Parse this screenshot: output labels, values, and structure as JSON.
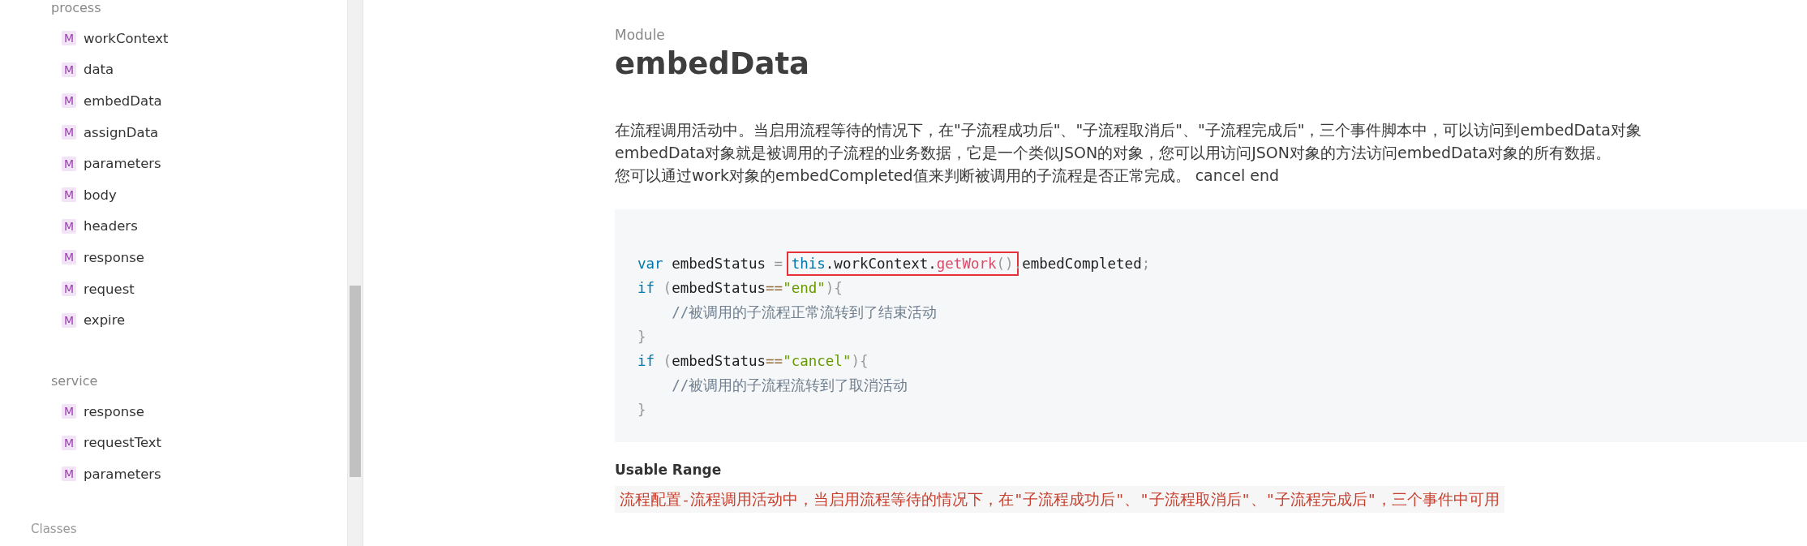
{
  "sidebar": {
    "groups": [
      {
        "title": "process",
        "items": [
          {
            "badge": "M",
            "label": "workContext"
          },
          {
            "badge": "M",
            "label": "data"
          },
          {
            "badge": "M",
            "label": "embedData"
          },
          {
            "badge": "M",
            "label": "assignData"
          },
          {
            "badge": "M",
            "label": "parameters"
          },
          {
            "badge": "M",
            "label": "body"
          },
          {
            "badge": "M",
            "label": "headers"
          },
          {
            "badge": "M",
            "label": "response"
          },
          {
            "badge": "M",
            "label": "request"
          },
          {
            "badge": "M",
            "label": "expire"
          }
        ]
      },
      {
        "title": "service",
        "items": [
          {
            "badge": "M",
            "label": "response"
          },
          {
            "badge": "M",
            "label": "requestText"
          },
          {
            "badge": "M",
            "label": "parameters"
          }
        ]
      }
    ],
    "section": "Classes"
  },
  "main": {
    "kicker": "Module",
    "title": "embedData",
    "description": [
      "在流程调用活动中。当启用流程等待的情况下，在\"子流程成功后\"、\"子流程取消后\"、\"子流程完成后\"，三个事件脚本中，可以访问到embedData对象",
      "embedData对象就是被调用的子流程的业务数据，它是一个类似JSON的对象，您可以用访问JSON对象的方法访问embedData对象的所有数据。",
      "您可以通过work对象的embedCompleted值来判断被调用的子流程是否正常完成。 cancel end"
    ],
    "code": [
      {
        "segments": [
          {
            "boxed": false,
            "tokens": [
              {
                "kind": "keyword",
                "text": "var"
              },
              {
                "kind": "plain",
                "text": " embedStatus "
              },
              {
                "kind": "punct",
                "text": "= "
              }
            ]
          },
          {
            "boxed": true,
            "tokens": [
              {
                "kind": "keyword",
                "text": "this"
              },
              {
                "kind": "plain",
                "text": ".workContext."
              },
              {
                "kind": "function",
                "text": "getWork"
              },
              {
                "kind": "punct",
                "text": "()"
              }
            ]
          },
          {
            "boxed": false,
            "tokens": [
              {
                "kind": "punct",
                "text": "."
              },
              {
                "kind": "plain",
                "text": "embedCompleted"
              },
              {
                "kind": "punct",
                "text": ";"
              }
            ]
          }
        ]
      },
      {
        "segments": [
          {
            "boxed": false,
            "tokens": [
              {
                "kind": "keyword",
                "text": "if"
              },
              {
                "kind": "punct",
                "text": " ("
              },
              {
                "kind": "plain",
                "text": "embedStatus"
              },
              {
                "kind": "operator",
                "text": "=="
              },
              {
                "kind": "string",
                "text": "\"end\""
              },
              {
                "kind": "punct",
                "text": "){"
              }
            ]
          }
        ]
      },
      {
        "segments": [
          {
            "boxed": false,
            "tokens": [
              {
                "kind": "comment",
                "text": "    //被调用的子流程正常流转到了结束活动"
              }
            ]
          }
        ]
      },
      {
        "segments": [
          {
            "boxed": false,
            "tokens": [
              {
                "kind": "punct",
                "text": "}"
              }
            ]
          }
        ]
      },
      {
        "segments": [
          {
            "boxed": false,
            "tokens": [
              {
                "kind": "keyword",
                "text": "if"
              },
              {
                "kind": "punct",
                "text": " ("
              },
              {
                "kind": "plain",
                "text": "embedStatus"
              },
              {
                "kind": "operator",
                "text": "=="
              },
              {
                "kind": "string",
                "text": "\"cancel\""
              },
              {
                "kind": "punct",
                "text": "){"
              }
            ]
          }
        ]
      },
      {
        "segments": [
          {
            "boxed": false,
            "tokens": [
              {
                "kind": "comment",
                "text": "    //被调用的子流程流转到了取消活动"
              }
            ]
          }
        ]
      },
      {
        "segments": [
          {
            "boxed": false,
            "tokens": [
              {
                "kind": "punct",
                "text": "}"
              }
            ]
          }
        ]
      }
    ],
    "usable_range": {
      "heading": "Usable Range",
      "text": "流程配置-流程调用活动中，当启用流程等待的情况下，在\"子流程成功后\"、\"子流程取消后\"、\"子流程完成后\"，三个事件中可用"
    }
  }
}
